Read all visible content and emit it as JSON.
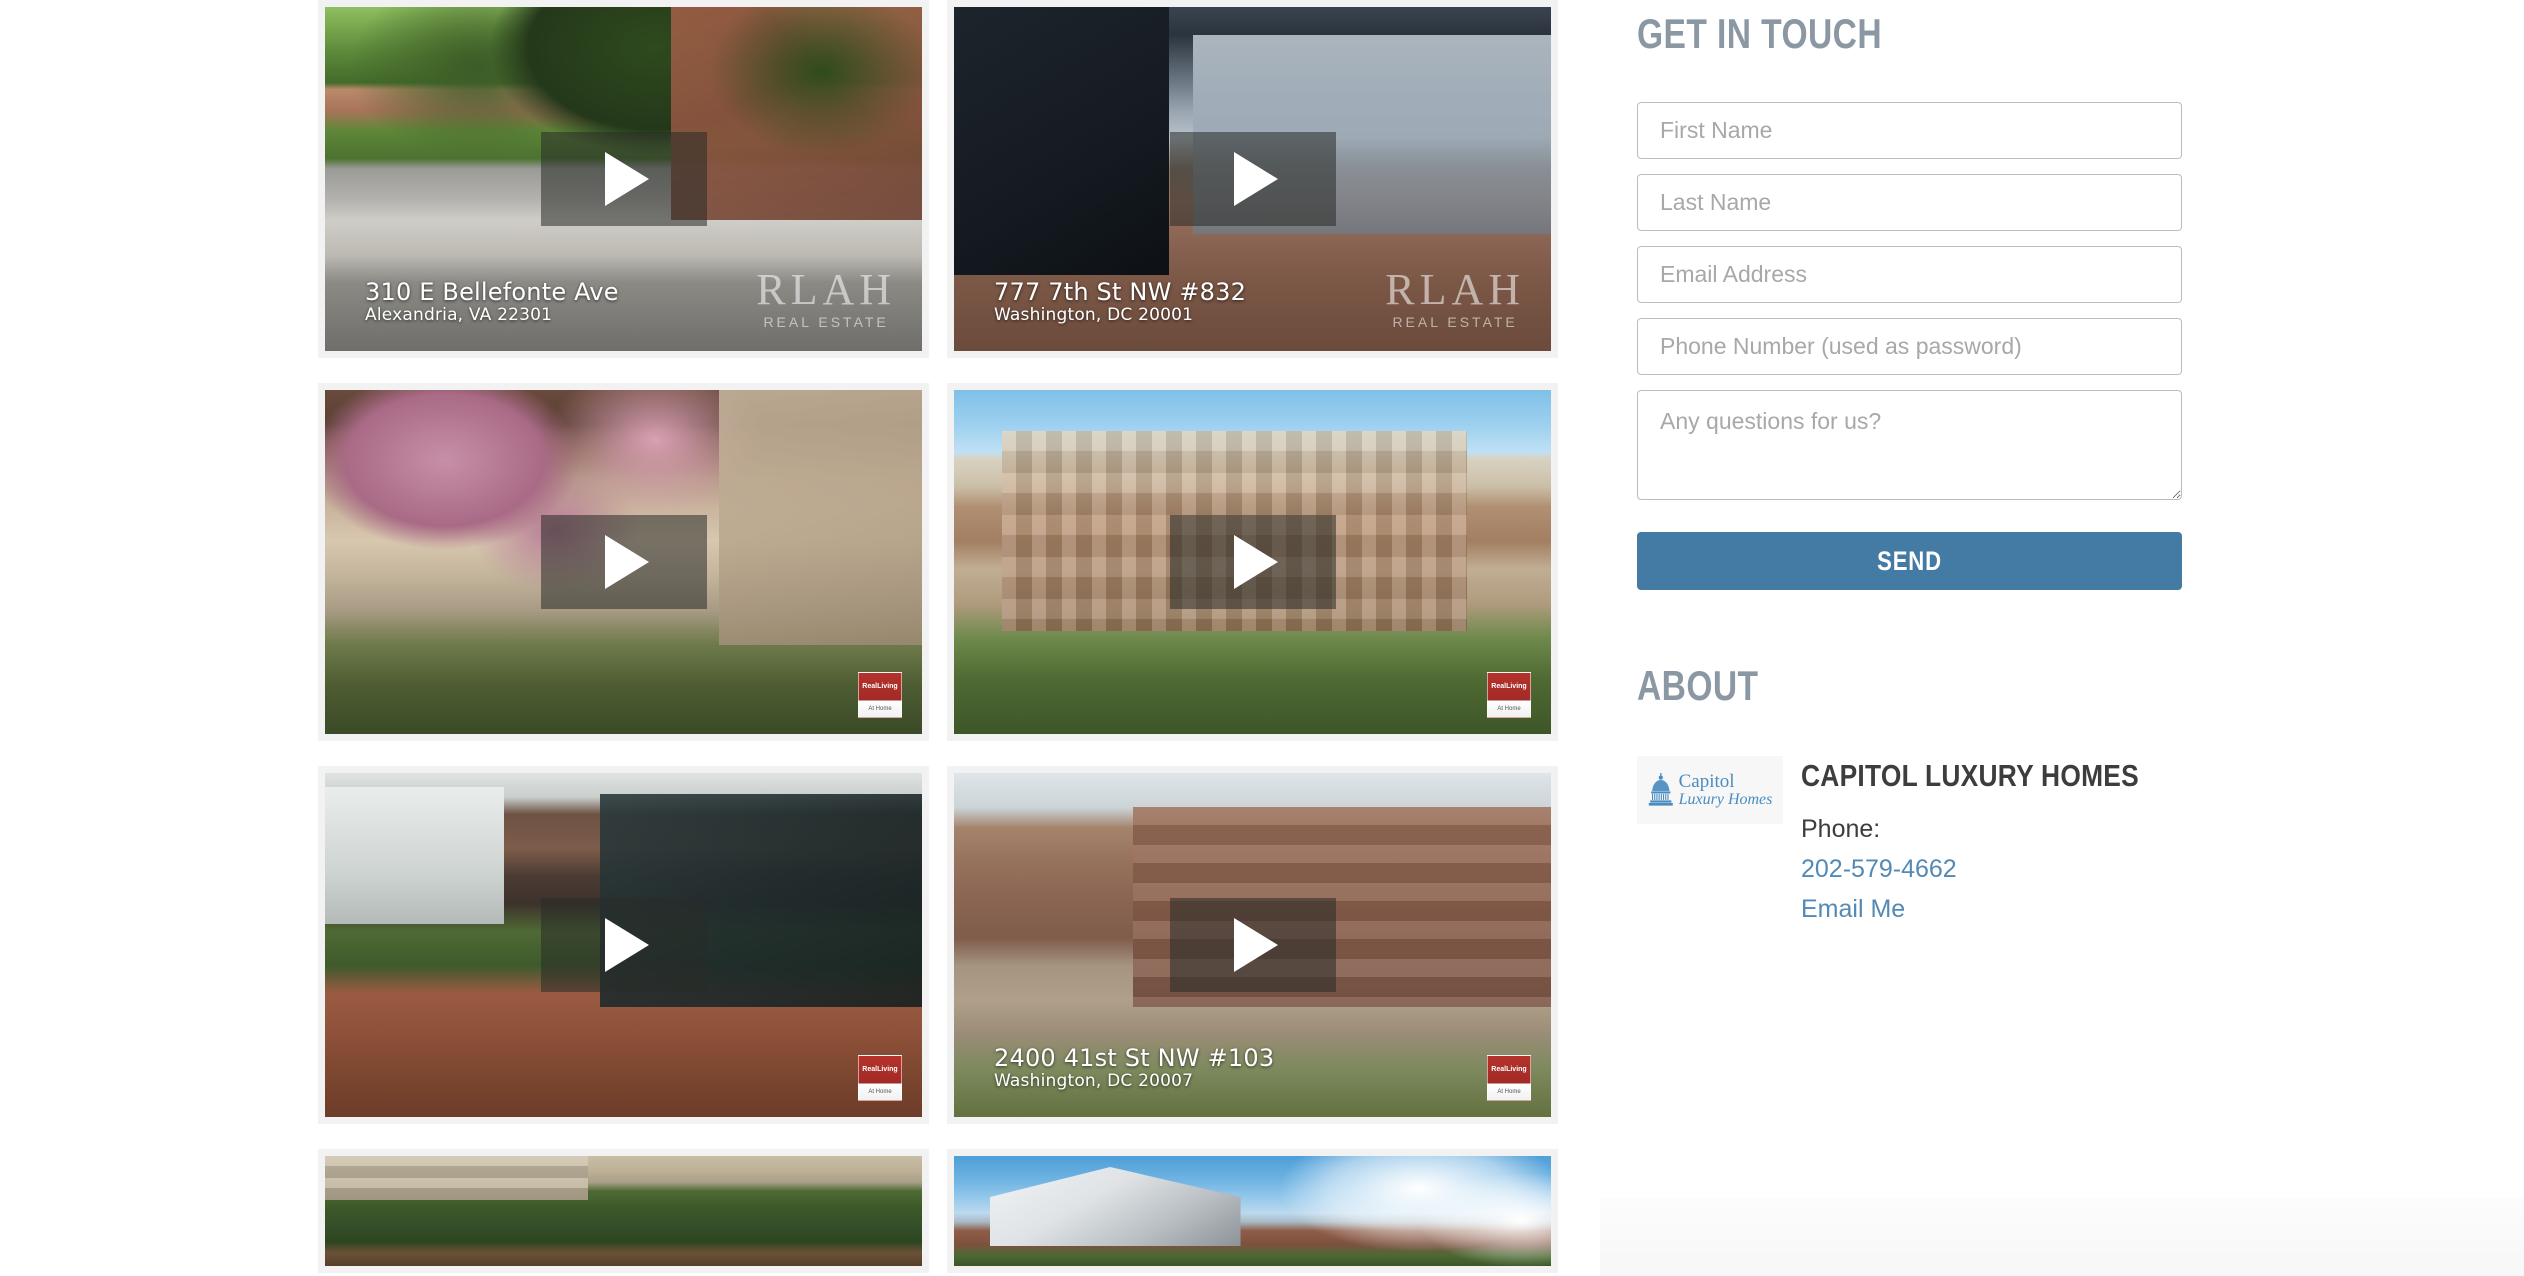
{
  "videos": {
    "rows": [
      [
        {
          "scene": "scene-1",
          "address_line1": "310 E Bellefonte Ave",
          "address_line2": "Alexandria, VA 22301",
          "watermark": "rlah",
          "watermark_big": "RLAH",
          "watermark_small": "REAL ESTATE",
          "play_label": "play-video"
        },
        {
          "scene": "scene-2",
          "address_line1": "777 7th St NW #832",
          "address_line2": "Washington, DC 20001",
          "watermark": "rlah",
          "watermark_big": "RLAH",
          "watermark_small": "REAL ESTATE",
          "play_label": "play-video"
        }
      ],
      [
        {
          "scene": "scene-3",
          "address_line1": "",
          "address_line2": "",
          "watermark": "realliving",
          "watermark_big": "RealLiving",
          "watermark_small": "At Home",
          "play_label": "play-video"
        },
        {
          "scene": "scene-4",
          "address_line1": "",
          "address_line2": "",
          "watermark": "realliving",
          "watermark_big": "RealLiving",
          "watermark_small": "At Home",
          "play_label": "play-video"
        }
      ],
      [
        {
          "scene": "scene-5",
          "address_line1": "",
          "address_line2": "",
          "watermark": "realliving",
          "watermark_big": "RealLiving",
          "watermark_small": "At Home",
          "play_label": "play-video"
        },
        {
          "scene": "scene-6",
          "address_line1": "2400 41st St NW #103",
          "address_line2": "Washington, DC 20007",
          "watermark": "realliving",
          "watermark_big": "RealLiving",
          "watermark_small": "At Home",
          "play_label": "play-video"
        }
      ],
      [
        {
          "scene": "scene-7",
          "address_line1": "",
          "address_line2": "",
          "watermark": "none",
          "watermark_big": "",
          "watermark_small": "",
          "play_label": "play-video"
        },
        {
          "scene": "scene-8",
          "address_line1": "",
          "address_line2": "",
          "watermark": "none",
          "watermark_big": "",
          "watermark_small": "",
          "play_label": "play-video"
        }
      ]
    ]
  },
  "contact": {
    "heading": "GET IN TOUCH",
    "fields": {
      "first_name": {
        "placeholder": "First Name",
        "value": ""
      },
      "last_name": {
        "placeholder": "Last Name",
        "value": ""
      },
      "email": {
        "placeholder": "Email Address",
        "value": ""
      },
      "phone": {
        "placeholder": "Phone Number (used as password)",
        "value": ""
      },
      "message": {
        "placeholder": "Any questions for us?",
        "value": ""
      }
    },
    "submit_label": "SEND",
    "submit_color": "#437ba4"
  },
  "about": {
    "heading": "ABOUT",
    "logo": {
      "word1": "Capitol",
      "word2": "Luxury Homes",
      "color": "#4a8cc0",
      "icon": "capitol-dome-icon"
    },
    "company_name": "CAPITOL LUXURY HOMES",
    "phone_label": "Phone:",
    "phone_number": "202-579-4662",
    "email_link_label": "Email Me",
    "link_color": "#5389b5"
  },
  "theme": {
    "heading_color": "#8b98a4",
    "text_color": "#3d3d3d",
    "card_bg": "#f2f2f2",
    "page_bg": "#ffffff",
    "input_border": "#bcbcbc"
  }
}
